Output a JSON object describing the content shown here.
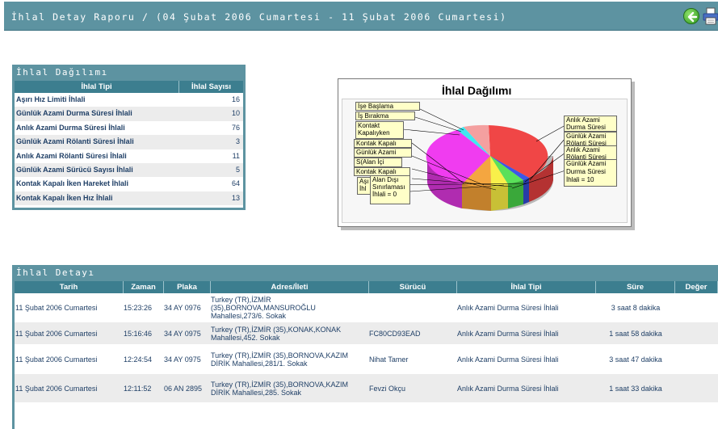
{
  "header": {
    "title": "İhlal Detay Raporu / (04 Şubat 2006 Cumartesi - 11 Şubat 2006 Cumartesi)"
  },
  "summary": {
    "section_title": "İhlal Dağılımı",
    "col_type": "İhlal Tipi",
    "col_count": "İhlal Sayısı",
    "rows": [
      {
        "type": "Aşırı Hız Limiti İhlali",
        "count": "16"
      },
      {
        "type": "Günlük Azami Durma Süresi İhlali",
        "count": "10"
      },
      {
        "type": "Anlık Azami Durma Süresi İhlali",
        "count": "76"
      },
      {
        "type": "Günlük Azami Rölanti Süresi İhlali",
        "count": "3"
      },
      {
        "type": "Anlık Azami Rölanti Süresi İhlali",
        "count": "11"
      },
      {
        "type": "Günlük Azami Sürücü Sayısı İhlali",
        "count": "5"
      },
      {
        "type": "Kontak Kapalı İken Hareket İhlali",
        "count": "64"
      },
      {
        "type": "Kontak Kapalı İken Hız İhlali",
        "count": "13"
      }
    ]
  },
  "chart": {
    "title": "İhlal Dağılımı",
    "labels": {
      "l1": "İşe Başlama",
      "l2": "İş Bırakma",
      "l3a": "Kontakt",
      "l3b": "Kapalıyken",
      "l4": "Kontak Kapalı",
      "l5": "Günlük Azami",
      "l6": "S(Alan İçi",
      "l7": "Kontak Kapalı",
      "l8a": "Aşı",
      "l8b": "İhl",
      "l9a": "Alan Dışı",
      "l9b": "Sınırlaması",
      "l9c": "İhlali = 0",
      "r1a": "Anlık Azami",
      "r1b": "Durma Süresi",
      "r2a": "Günlük Azami",
      "r2b": "Rölanti Süresi",
      "r3a": "Anlık Azami",
      "r3b": "Rölanti Süresi",
      "r4a": "Günlük Azami",
      "r4b": "Durma Süresi",
      "r4c": "İhlali = 10"
    },
    "colors": {
      "red": "#f04646",
      "magenta": "#f03cf0",
      "orange": "#f4a640",
      "yellow": "#f8f04a",
      "green": "#5ae05a",
      "blue": "#3c56e8",
      "pink": "#f4a0a0",
      "cyan": "#40e8f0"
    }
  },
  "chart_data": {
    "type": "pie",
    "title": "İhlal Dağılımı",
    "categories": [
      "Aşırı Hız Limiti İhlali",
      "Günlük Azami Durma Süresi İhlali",
      "Anlık Azami Durma Süresi İhlali",
      "Günlük Azami Rölanti Süresi İhlali",
      "Anlık Azami Rölanti Süresi İhlali",
      "Günlük Azami Sürücü Sayısı İhlali",
      "Kontak Kapalı İken Hareket İhlali",
      "Kontak Kapalı İken Hız İhlali"
    ],
    "values": [
      16,
      10,
      76,
      3,
      11,
      5,
      64,
      13
    ]
  },
  "detail": {
    "section_title": "İhlal Detayı",
    "columns": [
      "Tarih",
      "Zaman",
      "Plaka",
      "Adres/İleti",
      "Sürücü",
      "İhlal Tipi",
      "Süre",
      "Değer"
    ],
    "rows": [
      {
        "date": "11 Şubat 2006 Cumartesi",
        "time": "15:23:26",
        "plate": "34 AY 0976",
        "address": "Turkey (TR),İZMİR (35),BORNOVA,MANSUROĞLU Mahallesi,273/6. Sokak",
        "driver": "",
        "type": "Anlık Azami Durma Süresi İhlali",
        "duration": "3 saat  8 dakika",
        "value": ""
      },
      {
        "date": "11 Şubat 2006 Cumartesi",
        "time": "15:16:46",
        "plate": "34 AY 0975",
        "address": "Turkey (TR),İZMİR (35),KONAK,KONAK Mahallesi,452. Sokak",
        "driver": "FC80CD93EAD",
        "type": "Anlık Azami Durma Süresi İhlali",
        "duration": "1 saat 58 dakika",
        "value": ""
      },
      {
        "date": "11 Şubat 2006 Cumartesi",
        "time": "12:24:54",
        "plate": "34 AY 0975",
        "address": "Turkey (TR),İZMİR (35),BORNOVA,KAZIM DİRİK Mahallesi,281/1. Sokak",
        "driver": "Nihat Tamer",
        "type": "Anlık Azami Durma Süresi İhlali",
        "duration": "3 saat 47 dakika",
        "value": ""
      },
      {
        "date": "11 Şubat 2006 Cumartesi",
        "time": "12:11:52",
        "plate": "06 AN 2895",
        "address": "Turkey (TR),İZMİR (35),BORNOVA,KAZIM DİRİK Mahallesi,285. Sokak",
        "driver": "Fevzi Okçu",
        "type": "Anlık Azami Durma Süresi İhlali",
        "duration": "1 saat 33 dakika",
        "value": ""
      }
    ]
  }
}
